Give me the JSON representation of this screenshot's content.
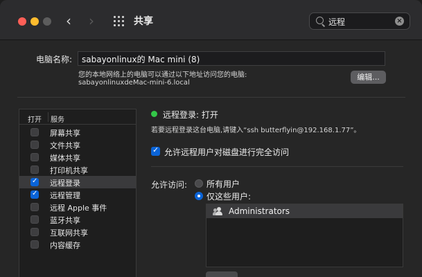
{
  "titlebar": {
    "title": "共享",
    "search_value": "远程",
    "clear_glyph": "×"
  },
  "computer_name": {
    "label": "电脑名称:",
    "value": "sabayonlinux的 Mac mini (8)",
    "desc_line1": "您的本地网络上的电脑可以通过以下地址访问您的电脑:",
    "desc_line2": "sabayonlinuxdeMac-mini-6.local",
    "edit_label": "编辑..."
  },
  "services": {
    "header_open": "打开",
    "header_name": "服务",
    "items": [
      {
        "label": "屏幕共享",
        "checked": false
      },
      {
        "label": "文件共享",
        "checked": false
      },
      {
        "label": "媒体共享",
        "checked": false
      },
      {
        "label": "打印机共享",
        "checked": false
      },
      {
        "label": "远程登录",
        "checked": true,
        "selected": true
      },
      {
        "label": "远程管理",
        "checked": true
      },
      {
        "label": "远程 Apple 事件",
        "checked": false
      },
      {
        "label": "蓝牙共享",
        "checked": false
      },
      {
        "label": "互联网共享",
        "checked": false
      },
      {
        "label": "内容缓存",
        "checked": false
      }
    ]
  },
  "detail": {
    "status": "远程登录: 打开",
    "status_color": "#33c748",
    "description": "若要远程登录这台电脑,请键入“ssh butterflyin@192.168.1.77”。",
    "allow_disk_label": "允许远程用户对磁盘进行完全访问",
    "allow_disk_checked": true,
    "access_label": "允许访问:",
    "access_options": [
      {
        "label": "所有用户",
        "selected": false
      },
      {
        "label": "仅这些用户:",
        "selected": true
      }
    ],
    "users": [
      "Administrators"
    ]
  },
  "colors": {
    "accent": "#0a64d8"
  }
}
